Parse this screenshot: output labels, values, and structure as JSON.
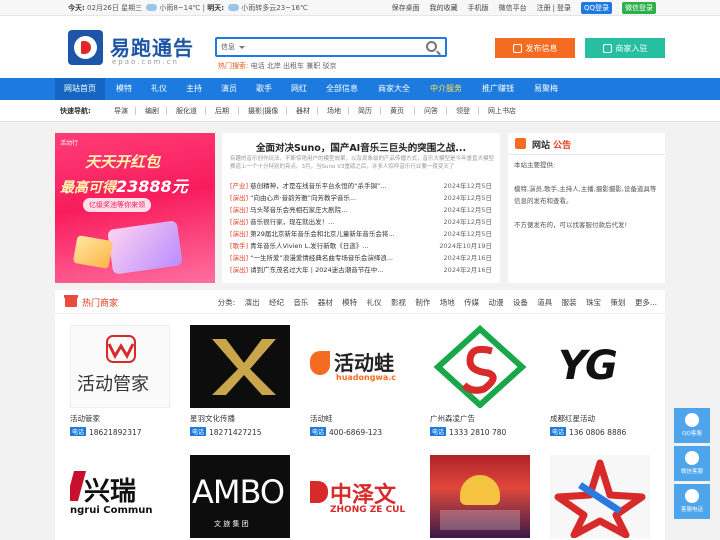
{
  "topbar": {
    "today": "今天:",
    "today_weather": "02月26日 星期三",
    "today_forecast": "小雨8~14℃",
    "tomorrow": "明天:",
    "tomorrow_forecast": "小雨转多云23~16℃",
    "links": [
      "保存桌面",
      "我的收藏",
      "手机版",
      "微信平台",
      "注册",
      "登录"
    ],
    "qq_login": "QQ登录",
    "wechat_login": "微信登录"
  },
  "header": {
    "logo_text": "易跑通告",
    "logo_sub": "epao.com.cn",
    "search_select": "信息",
    "hot_label": "热门搜索:",
    "hot_keywords": "电话 北岸 出租车 兼职 驳京",
    "publish_label": "发布信息",
    "join_label": "商家入驻"
  },
  "nav": [
    "网站首页",
    "模特",
    "礼仪",
    "主持",
    "演员",
    "歌手",
    "网红",
    "全部信息",
    "商家大全",
    "中介服务",
    "推广赚钱",
    "易聚梅"
  ],
  "quick": {
    "label": "快速导航:",
    "items": [
      "导演",
      "编剧",
      "服化道",
      "后期",
      "摄影|摄像",
      "器材",
      "场地",
      "简历",
      "黄页",
      "问答",
      "领登",
      "网上书店"
    ]
  },
  "banner": {
    "tag": "活动行",
    "line1": "天天开红包",
    "line2a": "最高可得",
    "line2b": "23888元",
    "line3": "亿级奖池等你来领"
  },
  "news": {
    "headline": "全面对决Suno，国产AI音乐三巨头的突围之战...",
    "summary": "有趣的音乐创作玩法，不断惊艳用户的模型效果，以及现象级的产品传播方式，音乐大模型是今年垂直大模型赛道上一个十分特别的亮点。3月，当Suno V3重磅之后，许多人惊呼音乐行业要一夜变天了",
    "rows": [
      {
        "cat": "[产业]",
        "title": "慈创精神，才是在线音乐平台永恒的“杀手锏”...",
        "date": "2024年12月5日"
      },
      {
        "cat": "[演出]",
        "title": "“向由心声·音韵芳雅”向芳教学音乐...",
        "date": "2024年12月5日"
      },
      {
        "cat": "[演出]",
        "title": "马头琴音乐会亮相石家庄大剧院...",
        "date": "2024年12月5日"
      },
      {
        "cat": "[演出]",
        "title": "音乐很行家，现在就出发！...",
        "date": "2024年12月5日"
      },
      {
        "cat": "[演出]",
        "title": "第29届北京新年音乐会和北京儿童新年音乐会将...",
        "date": "2024年12月5日"
      },
      {
        "cat": "[歌手]",
        "title": "青年音乐人Vivien L.发行新歌《日逝》...",
        "date": "2024年10月19日"
      },
      {
        "cat": "[演出]",
        "title": "“一生所爱”浪漫爱情经典名曲专场音乐会演绎浪...",
        "date": "2024年2月16日"
      },
      {
        "cat": "[演出]",
        "title": "请到广东茂名过大年丨2024迷古潮音节在中...",
        "date": "2024年2月16日"
      }
    ]
  },
  "notice": {
    "title_a": "网站",
    "title_b": "公告",
    "lines": [
      "本站主要提供:",
      "",
      "模特,演员,歌手,主持人,主播,摄影摄影,设备道具等信息的发布和查看。",
      "",
      "不方便发布的，可以找客服付款后代发!"
    ]
  },
  "merchants": {
    "title": "热门商家",
    "cats_label": "分类:",
    "cats": [
      "演出",
      "经纪",
      "音乐",
      "器材",
      "模特",
      "礼仪",
      "影视",
      "制作",
      "场地",
      "传媒",
      "动漫",
      "设备",
      "道具",
      "服装",
      "珠宝",
      "策划",
      "更多..."
    ],
    "phone_tag": "电话",
    "cards": [
      {
        "name": "活动管家",
        "tel": "18621892317",
        "img_text": "活动管家"
      },
      {
        "name": "星羽文化传播",
        "tel": "18271427215",
        "img_text": ""
      },
      {
        "name": "活动蛙",
        "tel": "400-6869-123",
        "img_text": "活动蛙",
        "img_sub": "huadongwa.c"
      },
      {
        "name": "广州森凌广告",
        "tel": "1333 2810 780",
        "img_text": ""
      },
      {
        "name": "成都红星活动",
        "tel": "136 0806 8886",
        "img_text": "YG"
      },
      {
        "name": "",
        "tel": "",
        "img_text": "兴瑞",
        "img_sub": "ngrui Commun"
      },
      {
        "name": "",
        "tel": "",
        "img_text": "AMBO",
        "img_sub": "文 旅 集 团"
      },
      {
        "name": "",
        "tel": "",
        "img_text": "中泽文",
        "img_sub": "ZHONG ZE CUL"
      },
      {
        "name": "",
        "tel": "",
        "img_text": ""
      },
      {
        "name": "",
        "tel": "",
        "img_text": ""
      }
    ]
  },
  "side": [
    "QQ客服",
    "微信客服",
    "客服电话"
  ],
  "colors": {
    "brand_blue": "#1d7be0",
    "accent_orange": "#f36c21",
    "accent_teal": "#27bfa1",
    "red": "#e03b1d"
  }
}
